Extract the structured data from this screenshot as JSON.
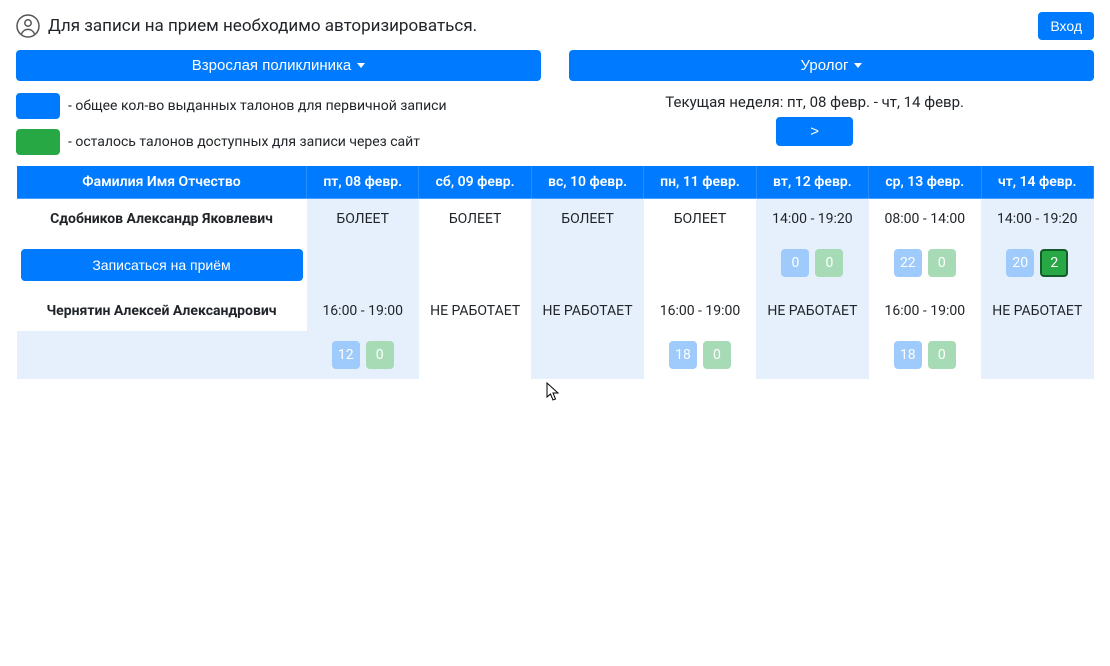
{
  "header": {
    "notice": "Для записи на прием необходимо авторизироваться.",
    "login_label": "Вход"
  },
  "filters": {
    "clinic_label": "Взрослая поликлиника",
    "specialty_label": "Уролог"
  },
  "legend": {
    "blue_text": "- общее кол-во выданных талонов для первичной записи",
    "green_text": "- осталось талонов доступных для записи через сайт"
  },
  "week": {
    "label": "Текущая неделя: пт, 08 февр. - чт, 14 февр.",
    "next_label": ">"
  },
  "table": {
    "headers": [
      "Фамилия Имя Отчество",
      "пт, 08 февр.",
      "сб, 09 февр.",
      "вс, 10 февр.",
      "пн, 11 февр.",
      "вт, 12 февр.",
      "ср, 13 февр.",
      "чт, 14 февр."
    ],
    "signup_label": "Записаться на приём",
    "doctors": [
      {
        "name": "Сдобников Александр Яковлевич",
        "days": [
          {
            "status": "БОЛЕЕТ",
            "shaded": true
          },
          {
            "status": "БОЛЕЕТ",
            "shaded": false
          },
          {
            "status": "БОЛЕЕТ",
            "shaded": true
          },
          {
            "status": "БОЛЕЕТ",
            "shaded": false
          },
          {
            "hours": "14:00 - 19:20",
            "total": "0",
            "avail": "0",
            "shaded": true,
            "strong": false
          },
          {
            "hours": "08:00 - 14:00",
            "total": "22",
            "avail": "0",
            "shaded": false,
            "strong": false
          },
          {
            "hours": "14:00 - 19:20",
            "total": "20",
            "avail": "2",
            "shaded": true,
            "strong": true
          }
        ]
      },
      {
        "name": "Чернятин Алексей Александрович",
        "days": [
          {
            "hours": "16:00 - 19:00",
            "total": "12",
            "avail": "0",
            "shaded": true,
            "strong": false
          },
          {
            "status": "НЕ РАБОТАЕТ",
            "shaded": false
          },
          {
            "status": "НЕ РАБОТАЕТ",
            "shaded": true
          },
          {
            "hours": "16:00 - 19:00",
            "total": "18",
            "avail": "0",
            "shaded": false,
            "strong": false
          },
          {
            "status": "НЕ РАБОТАЕТ",
            "shaded": true
          },
          {
            "hours": "16:00 - 19:00",
            "total": "18",
            "avail": "0",
            "shaded": false,
            "strong": false
          },
          {
            "status": "НЕ РАБОТАЕТ",
            "shaded": true
          }
        ]
      }
    ]
  }
}
